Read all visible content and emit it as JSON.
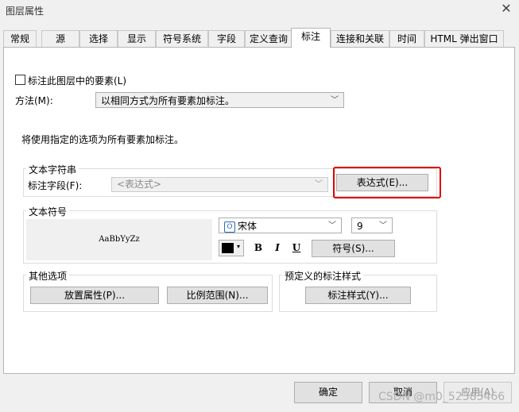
{
  "window": {
    "title": "图层属性",
    "close_glyph": "✕"
  },
  "tabs": [
    {
      "label": "常规"
    },
    {
      "label": "源"
    },
    {
      "label": "选择"
    },
    {
      "label": "显示"
    },
    {
      "label": "符号系统"
    },
    {
      "label": "字段"
    },
    {
      "label": "定义查询"
    },
    {
      "label": "标注"
    },
    {
      "label": "连接和关联"
    },
    {
      "label": "时间"
    },
    {
      "label": "HTML 弹出窗口"
    }
  ],
  "active_tab": "标注",
  "labeling": {
    "checkbox_label": "标注此图层中的要素(L)",
    "checkbox_checked": false,
    "method_label": "方法(M):",
    "method_value": "以相同方式为所有要素加标注。",
    "description": "将使用指定的选项为所有要素加标注。"
  },
  "text_string": {
    "group_label": "文本字符串",
    "field_label": "标注字段(F):",
    "field_value": "<表达式>",
    "expression_button": "表达式(E)..."
  },
  "text_symbol": {
    "group_label": "文本符号",
    "preview_text": "AaBbYyZz",
    "font_name": "宋体",
    "font_size": "9",
    "color": "#000000",
    "bold": "B",
    "italic": "I",
    "underline": "U",
    "symbol_button": "符号(S)..."
  },
  "other_options": {
    "group_label": "其他选项",
    "placement_button": "放置属性(P)...",
    "scale_button": "比例范围(N)..."
  },
  "predefined": {
    "group_label": "预定义的标注样式",
    "style_button": "标注样式(Y)..."
  },
  "footer": {
    "ok": "确定",
    "cancel": "取消",
    "apply": "应用(A)"
  },
  "watermark": "CSDN @m0_52383466",
  "colors": {
    "highlight_border": "#e00000"
  }
}
